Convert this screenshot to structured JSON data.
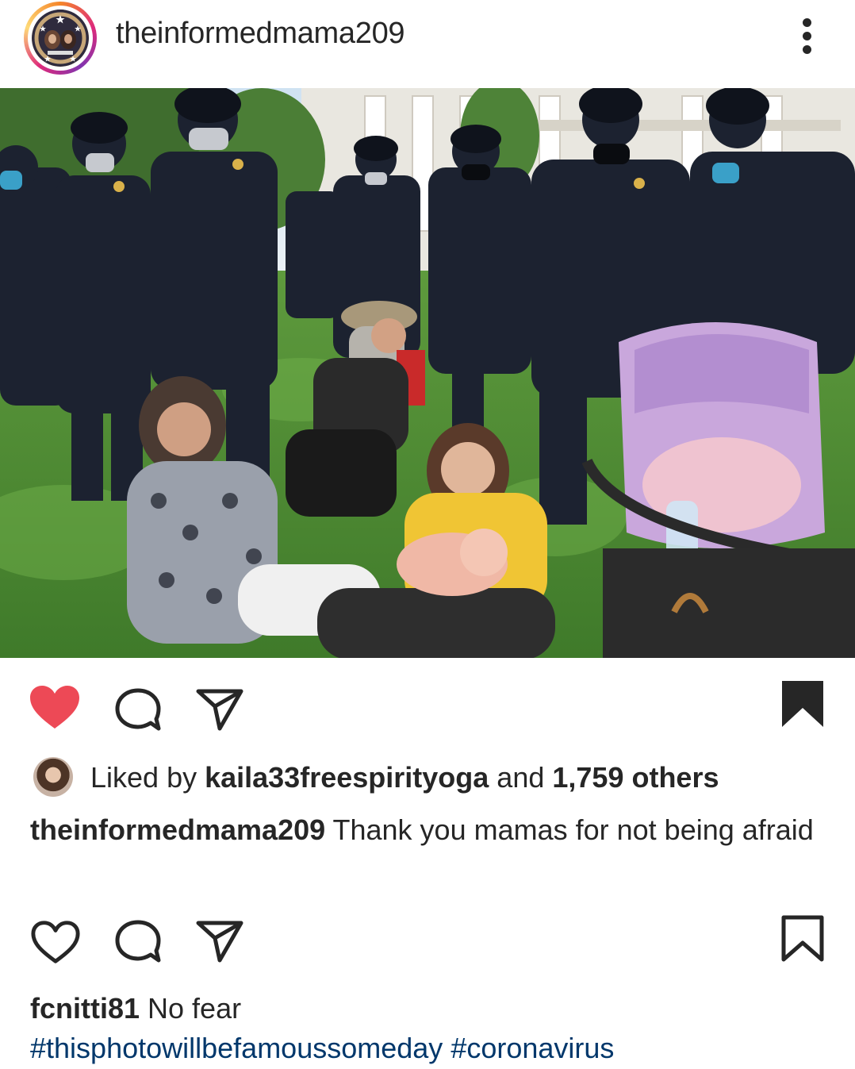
{
  "header": {
    "username": "theinformedmama209",
    "avatar_icon": "profile-avatar",
    "more_icon": "more-vertical-icon"
  },
  "post": {
    "photo_alt": "Riot police standing over mothers sitting on the grass with a baby and a pink stroller",
    "actions": {
      "like_state": "liked",
      "like_color": "#ed4956",
      "comment_icon": "comment-icon",
      "share_icon": "share-icon",
      "save_state": "saved"
    },
    "likes": {
      "prefix": "Liked by ",
      "liker": "kaila33freespirityoga",
      "middle": " and ",
      "others": "1,759 others"
    },
    "caption": {
      "username": "theinformedmama209",
      "text": " Thank you mamas for not being afraid"
    }
  },
  "second_actions": {
    "like_state": "not-liked",
    "save_state": "not-saved"
  },
  "comment": {
    "username": "fcnitti81",
    "text": " No fear",
    "hashtags": [
      "#thisphotowillbefamoussomeday",
      "#coronavirus"
    ]
  },
  "colors": {
    "text": "#262626",
    "link": "#00376b",
    "like_red": "#ed4956"
  }
}
